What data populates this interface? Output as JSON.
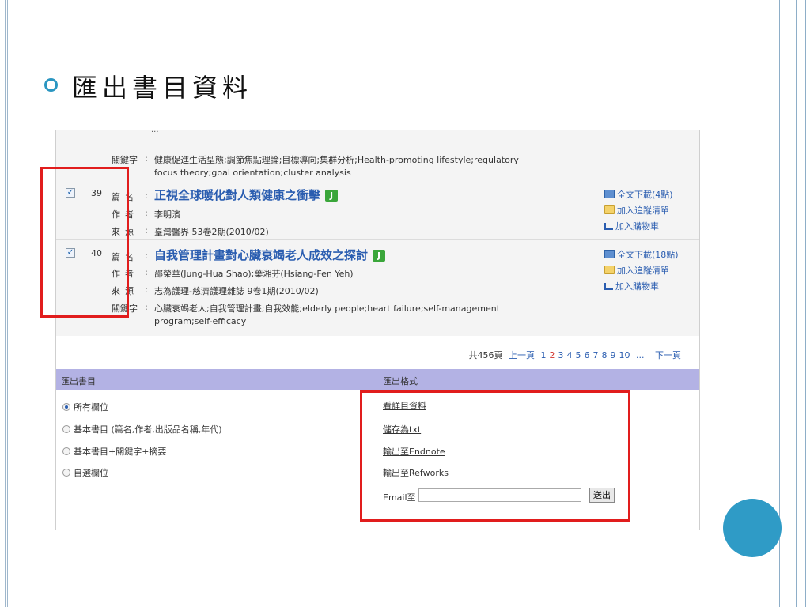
{
  "slide": {
    "heading": "匯出書目資料"
  },
  "results": {
    "prev_item": {
      "cut_text": "...",
      "keyword_label": "關鍵字",
      "keywords_line1": "健康促進生活型態;調節焦點理論;目標導向;集群分析;Health-promoting lifestyle;regulatory",
      "keywords_line2": "focus theory;goal orientation;cluster analysis"
    },
    "items": [
      {
        "checked": true,
        "number": "39",
        "title_label": "篇名",
        "title": "正視全球暖化對人類健康之衝擊",
        "badge": "J",
        "author_label": "作者",
        "author": "李明濱",
        "source_label": "來源",
        "source": "臺灣醫界 53卷2期(2010/02)",
        "actions": [
          "全文下載(4點)",
          "加入追蹤清單",
          "加入購物車"
        ]
      },
      {
        "checked": true,
        "number": "40",
        "title_label": "篇名",
        "title": "自我管理計畫對心臟衰竭老人成效之探討",
        "badge": "J",
        "author_label": "作者",
        "author": "邵榮華(Jung-Hua Shao);葉湘芬(Hsiang-Fen Yeh)",
        "source_label": "來源",
        "source": "志為護理-慈濟護理雜誌 9卷1期(2010/02)",
        "keyword_label": "關鍵字",
        "keywords_line1": "心臟衰竭老人;自我管理計畫;自我效能;elderly people;heart failure;self-management",
        "keywords_line2": "program;self-efficacy",
        "actions": [
          "全文下載(18點)",
          "加入追蹤清單",
          "加入購物車"
        ]
      }
    ]
  },
  "pager": {
    "total": "共456頁",
    "prev": "上一頁",
    "pages": [
      "1",
      "2",
      "3",
      "4",
      "5",
      "6",
      "7",
      "8",
      "9",
      "10"
    ],
    "current": "2",
    "ellipsis": "...",
    "next": "下一頁"
  },
  "export": {
    "header_left": "匯出書目",
    "header_right": "匯出格式",
    "options": [
      {
        "label": "所有欄位",
        "selected": true
      },
      {
        "label": "基本書目 (篇名,作者,出版品名稱,年代)",
        "selected": false
      },
      {
        "label": "基本書目+關鍵字+摘要",
        "selected": false
      },
      {
        "label": "自選欄位",
        "selected": false
      }
    ],
    "formats": [
      "看詳目資料",
      "儲存為txt",
      "輸出至Endnote",
      "輸出至Refworks"
    ],
    "email_label": "Email至",
    "email_value": "",
    "send_label": "送出"
  },
  "colors": {
    "accent_circle": "#2f9bc6",
    "highlight": "#e11d1d",
    "header_bar": "#b3b2e4",
    "link": "#2a5db0"
  }
}
